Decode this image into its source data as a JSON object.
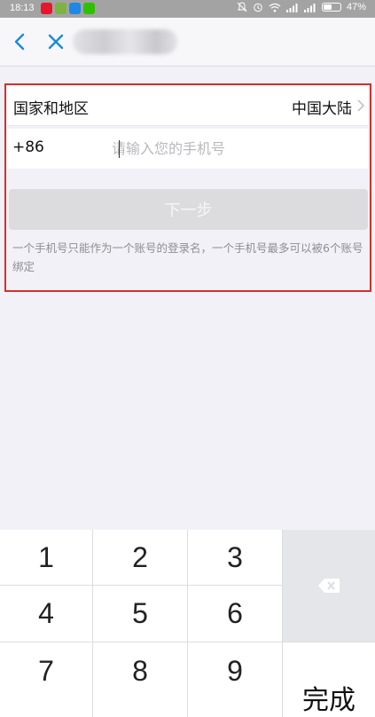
{
  "status_bar": {
    "time": "18:13",
    "battery": "47%",
    "app_icons": [
      {
        "name": "weibo-icon",
        "color": "#e6162d"
      },
      {
        "name": "android-icon",
        "color": "#7cb342"
      },
      {
        "name": "navigation-icon",
        "color": "#1e88e5"
      },
      {
        "name": "wechat-icon",
        "color": "#2dc100"
      }
    ]
  },
  "nav": {
    "back_icon": "back-arrow-icon",
    "close_icon": "close-icon",
    "accent_color": "#1a8cd8"
  },
  "form": {
    "country_label": "国家和地区",
    "country_value": "中国大陆",
    "country_code": "+86",
    "phone_placeholder": "请输入您的手机号",
    "phone_value": "",
    "next_label": "下一步",
    "hint": "一个手机号只能作为一个账号的登录名，一个手机号最多可以被6个账号绑定"
  },
  "keypad": {
    "keys": [
      "1",
      "2",
      "3",
      "4",
      "5",
      "6",
      "7",
      "8",
      "9"
    ],
    "done_label": "完成",
    "backspace_icon": "backspace-icon"
  }
}
